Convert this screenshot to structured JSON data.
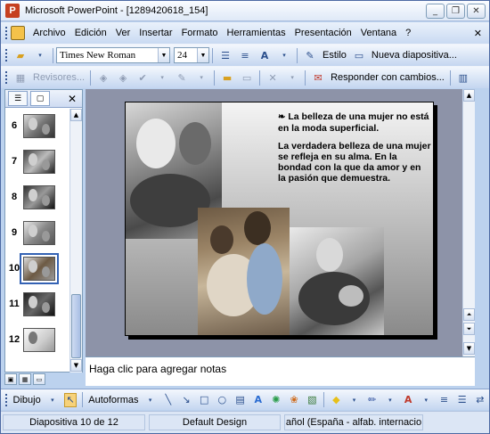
{
  "window": {
    "title": "Microsoft PowerPoint - [1289420618_154]",
    "controls": {
      "minimize": "_",
      "restore": "❐",
      "close": "✕"
    }
  },
  "menu": {
    "items": [
      "Archivo",
      "Edición",
      "Ver",
      "Insertar",
      "Formato",
      "Herramientas",
      "Presentación",
      "Ventana"
    ],
    "help": "?"
  },
  "toolbar1": {
    "font_name": "Times New Roman",
    "font_size": "24",
    "design_label": "Estilo",
    "new_slide_label": "Nueva diapositiva..."
  },
  "toolbar2": {
    "reviewers_label": "Revisores...",
    "reply_changes_label": "Responder con cambios..."
  },
  "slides_panel": {
    "thumbnails": [
      {
        "number": "6"
      },
      {
        "number": "7"
      },
      {
        "number": "8"
      },
      {
        "number": "9"
      },
      {
        "number": "10"
      },
      {
        "number": "11"
      },
      {
        "number": "12"
      }
    ],
    "selected": "10"
  },
  "slide": {
    "paragraphs": [
      "La belleza de una mujer no está en la moda superficial.",
      "La verdadera belleza de una mujer se refleja en su alma. En la bondad con la que da amor y en la pasión que demuestra."
    ],
    "bullet": "❧"
  },
  "notes": {
    "placeholder": "Haga clic para agregar notas"
  },
  "drawing_toolbar": {
    "draw_label": "Dibujo",
    "autoshapes_label": "Autoformas"
  },
  "status": {
    "slide_position": "Diapositiva 10 de 12",
    "design": "Default Design",
    "language": "añol (España - alfab. internacio"
  }
}
